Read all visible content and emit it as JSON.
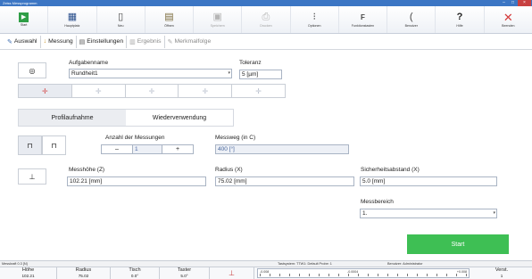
{
  "window": {
    "title": "Zeiss Messprogramm"
  },
  "toolbar": {
    "buttons": [
      {
        "label": "Start",
        "icon": "play-icon",
        "enabled": true,
        "color": "#2e9e46"
      },
      {
        "label": "Hauptplatz",
        "icon": "dashboard-icon",
        "enabled": true,
        "color": "#2a4f8c"
      },
      {
        "label": "Neu",
        "icon": "new-file-icon",
        "enabled": true,
        "color": "#444444"
      },
      {
        "label": "Öffnen",
        "icon": "open-icon",
        "enabled": true,
        "color": "#7a6a3a"
      },
      {
        "label": "Speichern",
        "icon": "save-icon",
        "enabled": false,
        "color": "#b5b5b5"
      },
      {
        "label": "Drucken",
        "icon": "print-icon",
        "enabled": false,
        "color": "#b5b5b5"
      },
      {
        "label": "Optionen",
        "icon": "options-icon",
        "enabled": true,
        "color": "#444444"
      },
      {
        "label": "Funktionstasten",
        "icon": "function-key-icon",
        "enabled": true,
        "color": "#444444"
      },
      {
        "label": "Benutzer",
        "icon": "user-icon",
        "enabled": true,
        "color": "#444444"
      },
      {
        "label": "Hilfe",
        "icon": "help-icon",
        "enabled": true,
        "color": "#222222"
      },
      {
        "label": "Beenden",
        "icon": "close-icon",
        "enabled": true,
        "color": "#d43a3a"
      }
    ]
  },
  "tabs": [
    {
      "label": "Auswahl",
      "icon": "select-icon",
      "enabled": true
    },
    {
      "label": "Messung",
      "icon": "measure-icon",
      "enabled": true
    },
    {
      "label": "Einstellungen",
      "icon": "settings-icon",
      "enabled": true
    },
    {
      "label": "Ergebnis",
      "icon": "result-icon",
      "enabled": false
    },
    {
      "label": "Merkmalfolge",
      "icon": "feature-sequence-icon",
      "enabled": false
    }
  ],
  "task": {
    "name_label": "Aufgabenname",
    "name_value": "Rundheit1",
    "tolerance_label": "Toleranz",
    "tolerance_value": "5 [µm]"
  },
  "probe_segments": [
    "crosshair-icon",
    "crosshair-left-icon",
    "crosshair-right-icon",
    "crosshair-up-icon",
    "crosshair-down-icon"
  ],
  "subtabs": {
    "profile": "Profilaufnahme",
    "reuse": "Wiederverwendung"
  },
  "measure": {
    "count_label": "Anzahl der Messungen",
    "count_value": "1",
    "minus": "–",
    "plus": "+",
    "path_label": "Messweg (in C)",
    "path_value": "400 [°]",
    "height_label": "Messhöhe (Z)",
    "height_value": "102.21 [mm]",
    "radius_label": "Radius (X)",
    "radius_value": "75.02 [mm]",
    "safety_label": "Sicherheitsabstand (X)",
    "safety_value": "5.0 [mm]",
    "range_label": "Messbereich",
    "range_value": "1."
  },
  "start": {
    "label": "Start",
    "color": "#3ebf54"
  },
  "status": {
    "left": "Messkraft 0.3 [N]",
    "middle": "Tastsystem: TTW1: Default Probe: 1",
    "right": "Benutzer: Administrator"
  },
  "bottom": {
    "columns": [
      {
        "header": "Höhe",
        "value": "102.21"
      },
      {
        "header": "Radius",
        "value": "75.02"
      },
      {
        "header": "Tisch",
        "value": "0.0°"
      },
      {
        "header": "Taster",
        "value": "5.0°"
      }
    ],
    "ruler_left": "-0.008",
    "ruler_mid": "-0.0004",
    "ruler_right": "+0.008",
    "verst_label": "Verst.",
    "verst_value": "1"
  }
}
